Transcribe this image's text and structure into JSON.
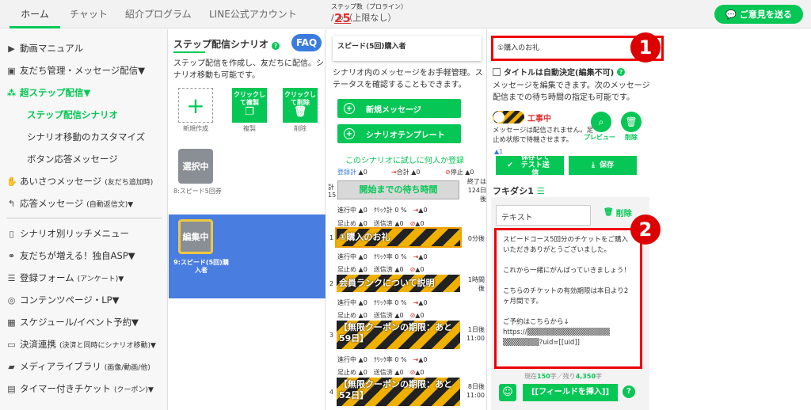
{
  "topbar": {
    "tabs": [
      "ホーム",
      "チャット",
      "紹介プログラム",
      "LINE公式アカウント"
    ],
    "step_label": "ステップ数（プロライン）",
    "step_count": "25",
    "step_rest": "/ ∞（上限なし）",
    "feedback": "ご意見を送る"
  },
  "sidebar": {
    "items": [
      {
        "icon": "video-icon",
        "label": "動画マニュアル"
      },
      {
        "icon": "contacts-icon",
        "label": "友だち管理・メッセージ配信▼"
      },
      {
        "icon": "network-icon",
        "label": "超ステップ配信▼"
      },
      {
        "label": "ステップ配信シナリオ"
      },
      {
        "label": "シナリオ移動のカスタマイズ"
      },
      {
        "label": "ボタン応答メッセージ"
      },
      {
        "icon": "hand-icon",
        "label": "あいさつメッセージ",
        "small": "(友だち追加時)"
      },
      {
        "icon": "reply-icon",
        "label": "応答メッセージ",
        "small": "(自動返信文)▼"
      },
      {
        "icon": "phone-icon",
        "label": "シナリオ別リッチメニュー"
      },
      {
        "icon": "handshake-icon",
        "label": "友だちが増える！独自ASP▼"
      },
      {
        "icon": "list-icon",
        "label": "登録フォーム",
        "small": "(アンケート)▼"
      },
      {
        "icon": "globe-icon",
        "label": "コンテンツページ・LP▼"
      },
      {
        "icon": "calendar-icon",
        "label": "スケジュール/イベント予約▼"
      },
      {
        "icon": "card-icon",
        "label": "決済連携",
        "small": "(決済と同時にシナリオ移動)▼"
      },
      {
        "icon": "folder-icon",
        "label": "メディアライブラリ",
        "small": "(画像/動画/他)"
      },
      {
        "icon": "ticket-icon",
        "label": "タイマー付きチケット",
        "small": "(クーポン)▼"
      }
    ]
  },
  "scenario_panel": {
    "title": "ステップ配信シナリオ",
    "faq": "FAQ",
    "desc": "ステップ配信を作成し、友だちに配信。シナリオ移動も可能です。",
    "new_label": "新規作成",
    "copy_btn": "クリックして複製",
    "copy_label": "複製",
    "delete_btn": "クリックして削除",
    "delete_label": "削除",
    "card1_badge": "選択中",
    "card1_name": "8:スピード5回券",
    "card2_badge": "編集中",
    "card2_name": "9:スピード(5回)購入者"
  },
  "timeline": {
    "scenario_name": "スピード(5回)購入者",
    "desc": "シナリオ内のメッセージをお手軽管理。ステータスを確認することもできます。",
    "new_message": "新規メッセージ",
    "template": "シナリオテンプレート",
    "try_link": "このシナリオに試しに何人か登録",
    "stats_top": {
      "reg": "登録計",
      "total": "合計",
      "stop": "停止",
      "zero": "0"
    },
    "total_label": "計",
    "total_days": "15",
    "end_label": "終了は124日後",
    "wait_btn": "開始までの待ち時間",
    "row_labels": {
      "progress": "進行中",
      "click": "ｸﾘｯｸ計",
      "click_rate": "ｸﾘｯｸ率",
      "sent": "送信済",
      "stopped": "足止め",
      "zero": "0",
      "zero_pct": "0 %"
    },
    "messages": [
      {
        "num": "1",
        "title": "①購入のお礼",
        "timing": "0分後"
      },
      {
        "num": "2",
        "title": "会員ランクについて説明",
        "timing": "1時間後"
      },
      {
        "num": "3",
        "title": "【無限クーポンの期限：あと59日】",
        "timing": "1日後 11:00"
      },
      {
        "num": "4",
        "title": "【無限クーポンの期限：あと52日】",
        "timing": "8日後 11:00"
      }
    ]
  },
  "editor": {
    "msg_title": "①購入のお礼",
    "badge1": "1",
    "badge2": "2",
    "auto_title": "タイトルは自動決定(編集不可)",
    "desc": "メッセージを編集できます。次のメッセージ配信までの待ち時間の指定も可能です。",
    "status": "工事中",
    "status_desc": "メッセージは配信されません。足止め状態で待機させます。",
    "preview": "プレビュー",
    "delete": "削除",
    "save_test": "保存して テスト送信",
    "save": "保存",
    "user_count": "1",
    "fukidashi": "フキダシ1",
    "text_tab": "テキスト",
    "text_delete": "削除",
    "body": "スピードコース5回分のチケットをご購入いただきありがとうございました。\n\nこれから一緒にがんばっていきましょう！\n\nこちらのチケットの有効期限は本日より2ヶ月間です。\n\nご予約はこちらから↓\nhttps://▒▒▒▒▒▒▒▒▒▒▒▒▒▒▒▒\n▒▒▒▒▒▒▒?uid=[[uid]]",
    "count_prefix": "現在",
    "count_now": "150",
    "count_mid": "字／残り",
    "count_left": "4,350",
    "count_suffix": "字",
    "insert": "[[フィールドを挿入]]"
  }
}
